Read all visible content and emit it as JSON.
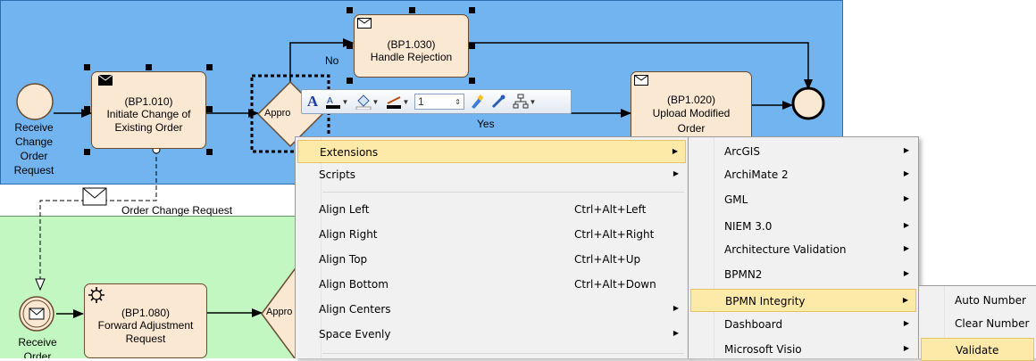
{
  "diagram": {
    "events": {
      "receive_change_order_request": [
        "Receive",
        "Change",
        "Order",
        "Request"
      ],
      "receive_order": [
        "Receive",
        "Order"
      ]
    },
    "tasks": {
      "bp1010": {
        "id": "(BP1.010)",
        "name": "Initiate Change of Existing Order"
      },
      "bp1030": {
        "id": "(BP1.030)",
        "name": "Handle Rejection"
      },
      "bp1020": {
        "id": "(BP1.020)",
        "name": "Upload Modified Order"
      },
      "bp1080": {
        "id": "(BP1.080)",
        "name": "Forward Adjustment Request"
      }
    },
    "gateways": {
      "top": "Appro",
      "bottom": "Appro"
    },
    "flow_labels": {
      "no": "No",
      "yes": "Yes"
    },
    "message_flow_label": "Order Change Request"
  },
  "toolbar": {
    "line_width": "1",
    "icons": [
      "font-icon",
      "font-color-icon",
      "fill-color-icon",
      "line-color-icon",
      "apply-style-icon",
      "eyedropper-icon",
      "layout-icon"
    ]
  },
  "context_menu": {
    "items": [
      {
        "label": "Extensions",
        "submenu": true
      },
      {
        "label": "Scripts",
        "submenu": true
      },
      {
        "label": "Align Left",
        "shortcut": "Ctrl+Alt+Left"
      },
      {
        "label": "Align Right",
        "shortcut": "Ctrl+Alt+Right"
      },
      {
        "label": "Align Top",
        "shortcut": "Ctrl+Alt+Up"
      },
      {
        "label": "Align Bottom",
        "shortcut": "Ctrl+Alt+Down"
      },
      {
        "label": "Align Centers",
        "submenu": true
      },
      {
        "label": "Space Evenly",
        "submenu": true
      }
    ]
  },
  "extensions_menu": {
    "items": [
      "ArcGIS",
      "ArchiMate 2",
      "GML",
      "NIEM 3.0",
      "Architecture Validation",
      "BPMN2",
      "BPMN Integrity",
      "Dashboard",
      "Microsoft Visio"
    ]
  },
  "bpmn_integrity_menu": {
    "items": [
      "Auto Number",
      "Clear Number",
      "Validate"
    ]
  },
  "colors": {
    "pool_top": "#72b4f0",
    "pool_bottom": "#c2f7c2",
    "task_fill": "#fbe8d3",
    "menu_highlight": "#fde9a8"
  }
}
